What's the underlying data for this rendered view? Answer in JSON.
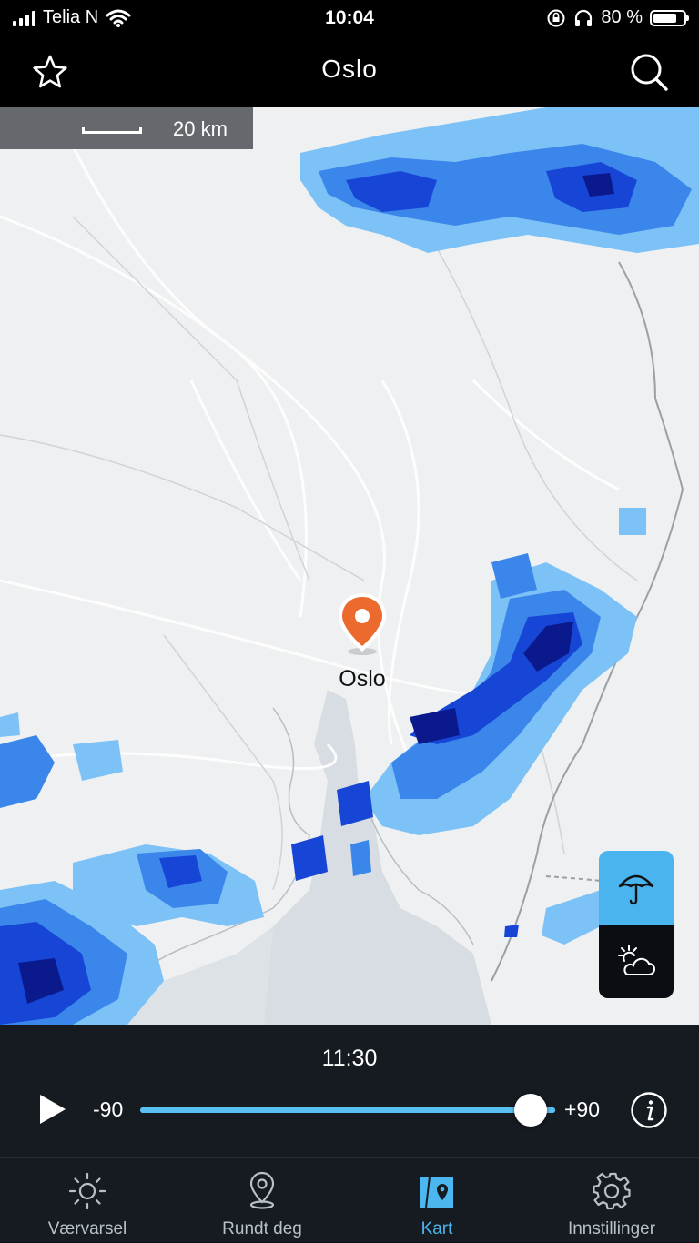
{
  "status_bar": {
    "carrier": "Telia N",
    "time": "10:04",
    "battery_text": "80 %",
    "battery_level": 0.8
  },
  "header": {
    "title": "Oslo",
    "favorite_icon": "star-icon",
    "search_icon": "search-icon"
  },
  "map": {
    "scale_label": "20 km",
    "location_label": "Oslo",
    "pin_color": "#ec6a2d",
    "precip_colors": [
      "#0a1a8c",
      "#1746d6",
      "#3b86ea",
      "#7dc2f6",
      "#b7e2fb"
    ],
    "layers": [
      {
        "name": "precipitation",
        "icon": "umbrella-icon",
        "active": true,
        "color": "#4ab4ee"
      },
      {
        "name": "weather",
        "icon": "sun-cloud-icon",
        "active": false,
        "color": "#0a0e13"
      }
    ]
  },
  "player": {
    "time": "11:30",
    "min_label": "-90",
    "max_label": "+90",
    "position_fraction": 1.0,
    "play_icon": "play-icon",
    "info_icon": "info-icon"
  },
  "tabs": [
    {
      "label": "Værvarsel",
      "icon": "sun-icon",
      "active": false
    },
    {
      "label": "Rundt deg",
      "icon": "location-pin-icon",
      "active": false
    },
    {
      "label": "Kart",
      "icon": "map-icon",
      "active": true
    },
    {
      "label": "Innstillinger",
      "icon": "gear-icon",
      "active": false
    }
  ],
  "accent_color": "#4cb6ef"
}
